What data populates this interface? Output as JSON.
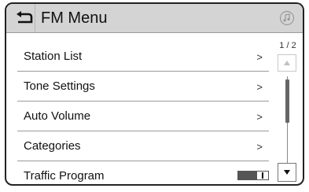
{
  "header": {
    "title": "FM Menu",
    "back_icon": "back-arrow-icon",
    "right_icon": "music-note-icon"
  },
  "menu": {
    "items": [
      {
        "label": "Station List",
        "control": ">"
      },
      {
        "label": "Tone Settings",
        "control": ">"
      },
      {
        "label": "Auto Volume",
        "control": ">"
      },
      {
        "label": "Categories",
        "control": ">"
      },
      {
        "label": "Traffic Program",
        "control": "toggle",
        "toggle_state": "off"
      }
    ]
  },
  "scroll": {
    "page_indicator": "1 / 2",
    "up_icon": "up-arrow-icon",
    "down_icon": "down-arrow-icon"
  }
}
